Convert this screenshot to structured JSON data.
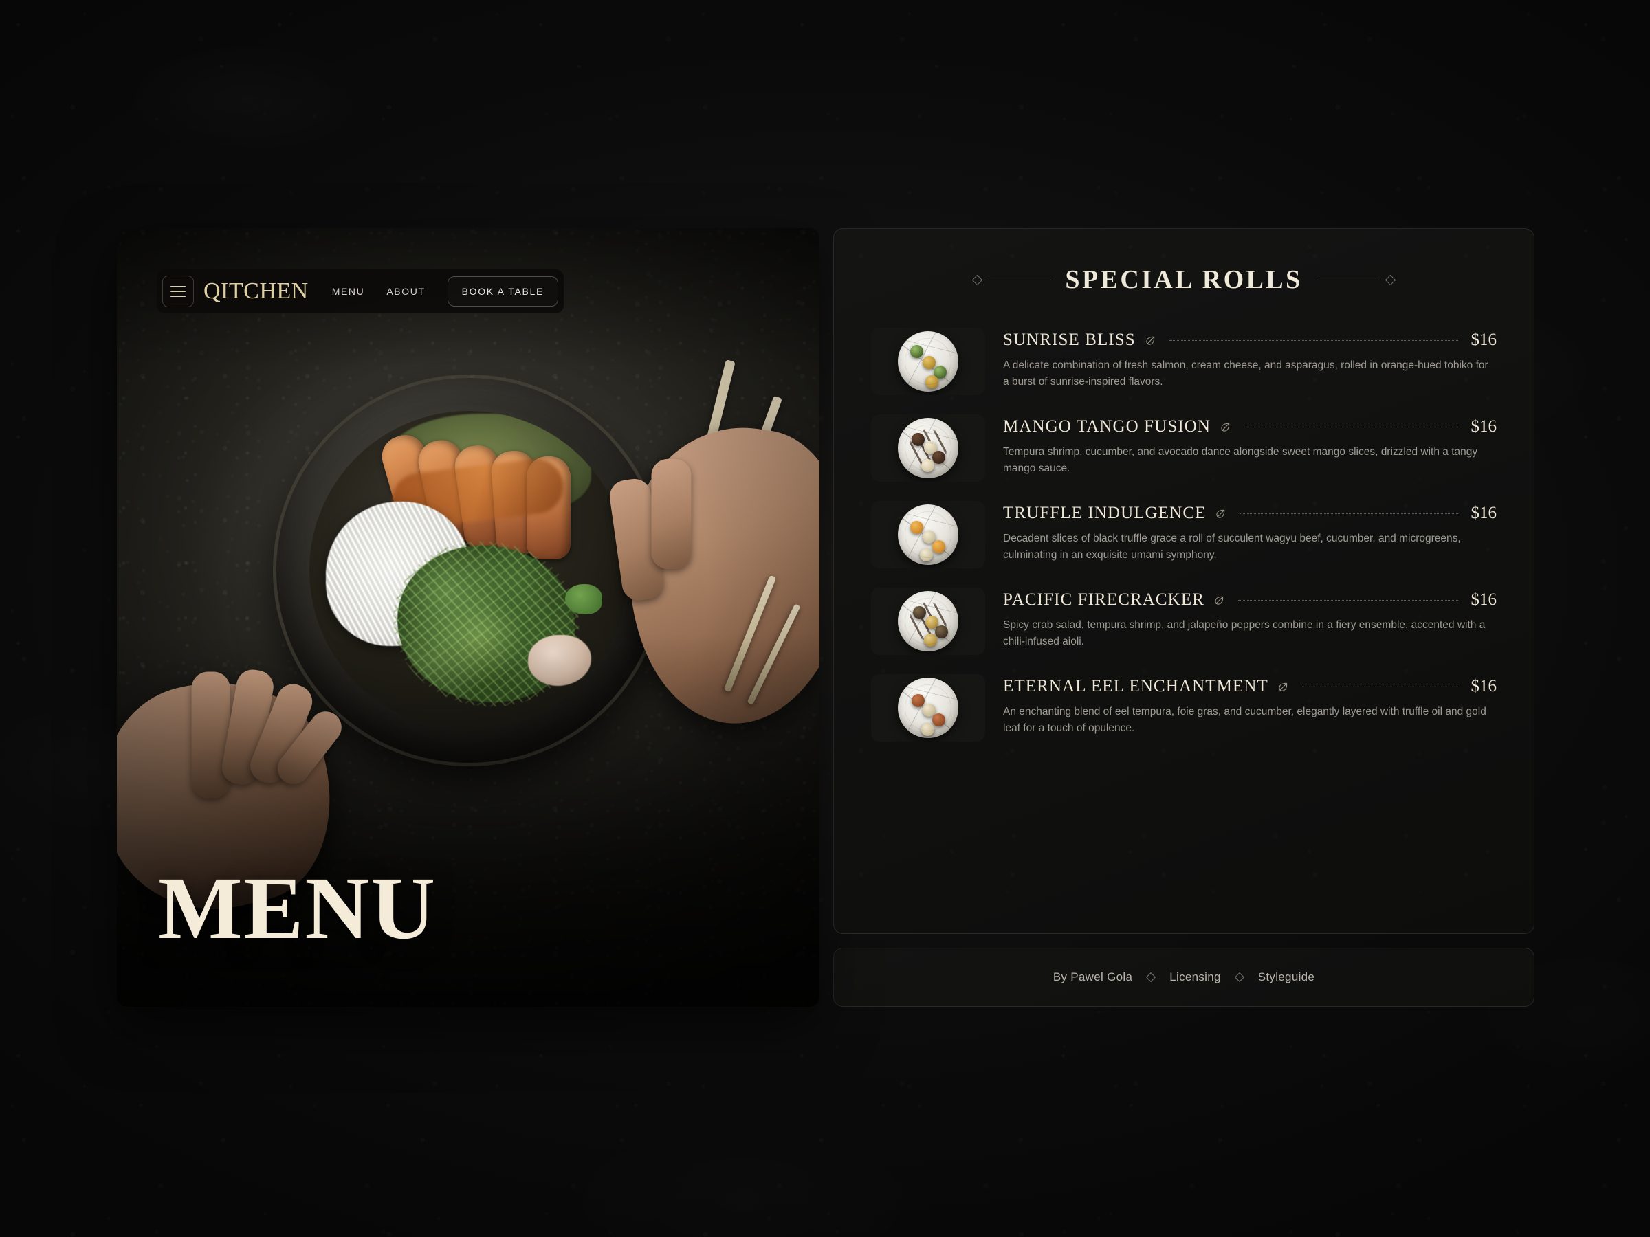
{
  "navbar": {
    "menu_icon": "hamburger-menu-icon",
    "logo": "QITCHEN",
    "links": [
      {
        "label": "MENU"
      },
      {
        "label": "ABOUT"
      }
    ],
    "cta": "BOOK A TABLE"
  },
  "hero": {
    "title": "MENU",
    "photo_alt": "Overhead shot of a dark ceramic bowl with seared salmon, daikon noodles and greens, held by two hands with chopsticks on a dark stone table"
  },
  "menu": {
    "section_title": "SPECIAL ROLLS",
    "ornament_icon": "diamond-ornament-icon",
    "dietary_icon": "leaf-icon",
    "items": [
      {
        "name": "SUNRISE BLISS",
        "price": "$16",
        "description": "A delicate combination of fresh salmon, cream cheese, and asparagus, rolled in orange-hued tobiko for a burst of sunrise-inspired flavors.",
        "thumb_alt": "sunrise-bliss-roll-photo"
      },
      {
        "name": "MANGO TANGO FUSION",
        "price": "$16",
        "description": "Tempura shrimp, cucumber, and avocado dance alongside sweet mango slices, drizzled with a tangy mango sauce.",
        "thumb_alt": "mango-tango-fusion-roll-photo"
      },
      {
        "name": "TRUFFLE INDULGENCE",
        "price": "$16",
        "description": "Decadent slices of black truffle grace a roll of succulent wagyu beef, cucumber, and microgreens, culminating in an exquisite umami symphony.",
        "thumb_alt": "truffle-indulgence-roll-photo"
      },
      {
        "name": "PACIFIC FIRECRACKER",
        "price": "$16",
        "description": "Spicy crab salad, tempura shrimp, and jalapeño peppers combine in a fiery ensemble, accented with a chili-infused aioli.",
        "thumb_alt": "pacific-firecracker-roll-photo"
      },
      {
        "name": "ETERNAL EEL ENCHANTMENT",
        "price": "$16",
        "description": "An enchanting blend of eel tempura, foie gras, and cucumber, elegantly layered with truffle oil and gold leaf for a touch of opulence.",
        "thumb_alt": "eternal-eel-enchantment-roll-photo"
      }
    ]
  },
  "footer": {
    "links": [
      {
        "label": "By Pawel Gola"
      },
      {
        "label": "Licensing"
      },
      {
        "label": "Styleguide"
      }
    ],
    "separator_icon": "diamond-separator-icon"
  },
  "colors": {
    "page_background": "#0a0a0a",
    "panel_background": "#121110",
    "gold_accent": "#ded0a4",
    "cream_text": "#f4ecd8",
    "body_text": "#9e9b93",
    "border": "rgba(235,230,215,0.11)"
  }
}
